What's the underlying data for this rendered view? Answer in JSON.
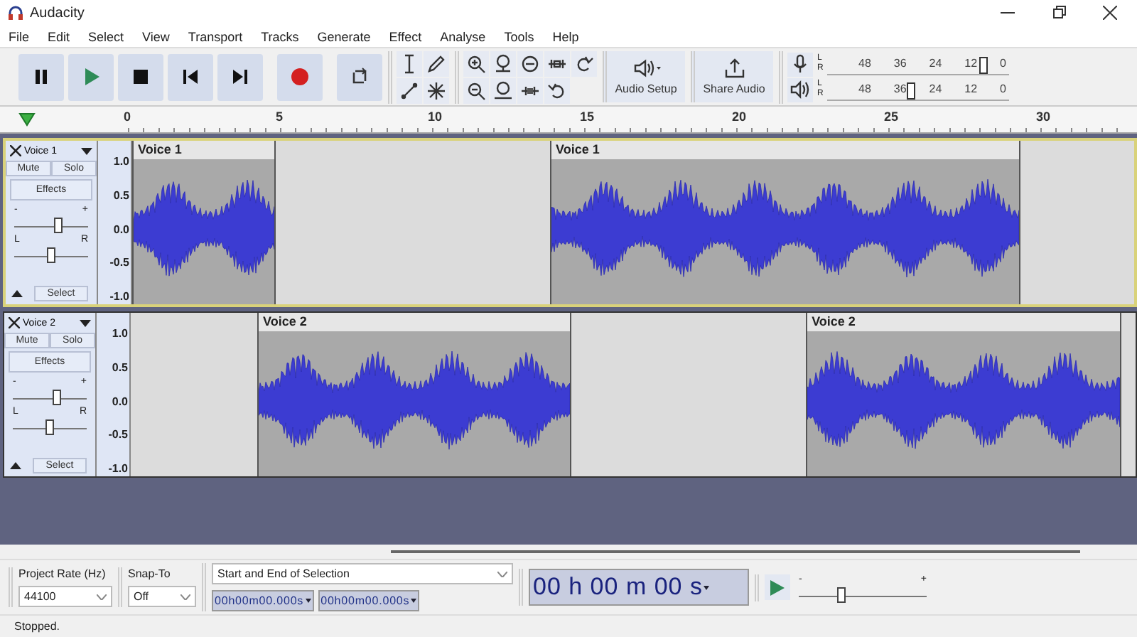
{
  "window": {
    "title": "Audacity"
  },
  "menu": [
    "File",
    "Edit",
    "Select",
    "View",
    "Transport",
    "Tracks",
    "Generate",
    "Effect",
    "Analyse",
    "Tools",
    "Help"
  ],
  "toolbar": {
    "audio_setup": "Audio Setup",
    "share_audio": "Share Audio"
  },
  "meters": [
    {
      "kind": "record",
      "channels": [
        "L",
        "R"
      ],
      "scale": [
        "48",
        "36",
        "24",
        "12",
        "0"
      ],
      "level": 0.86
    },
    {
      "kind": "play",
      "channels": [
        "L",
        "R"
      ],
      "scale": [
        "48",
        "36",
        "24",
        "12",
        "0"
      ],
      "level": 0.46
    }
  ],
  "ruler": [
    "0",
    "5",
    "10",
    "15",
    "20",
    "25",
    "30"
  ],
  "tracks": [
    {
      "name": "Voice 1",
      "selected": true,
      "mute": "Mute",
      "solo": "Solo",
      "effects": "Effects",
      "select": "Select",
      "gain": {
        "minus": "-",
        "plus": "+",
        "level": 0.6
      },
      "pan": {
        "left": "L",
        "right": "R",
        "level": 0.5
      },
      "scale": [
        "1.0",
        "0.5",
        "0.0",
        "-0.5",
        "-1.0"
      ],
      "clips": [
        {
          "title": "Voice 1"
        },
        {
          "title": "Voice 1"
        }
      ]
    },
    {
      "name": "Voice 2",
      "selected": false,
      "mute": "Mute",
      "solo": "Solo",
      "effects": "Effects",
      "select": "Select",
      "gain": {
        "minus": "-",
        "plus": "+",
        "level": 0.6
      },
      "pan": {
        "left": "L",
        "right": "R",
        "level": 0.5
      },
      "scale": [
        "1.0",
        "0.5",
        "0.0",
        "-0.5",
        "-1.0"
      ],
      "clips": [
        {
          "title": "Voice 2"
        },
        {
          "title": "Voice 2"
        }
      ]
    }
  ],
  "bottom": {
    "project_rate": {
      "label": "Project Rate (Hz)",
      "value": "44100"
    },
    "snap_to": {
      "label": "Snap-To",
      "value": "Off"
    },
    "selection": {
      "mode": "Start and End of Selection",
      "start": "00h00m00.000s",
      "end": "00h00m00.000s"
    },
    "time": "00 h 00 m 00 s",
    "speed": {
      "minus": "-",
      "plus": "+",
      "level": 0.33
    }
  },
  "status_bar": "Stopped."
}
